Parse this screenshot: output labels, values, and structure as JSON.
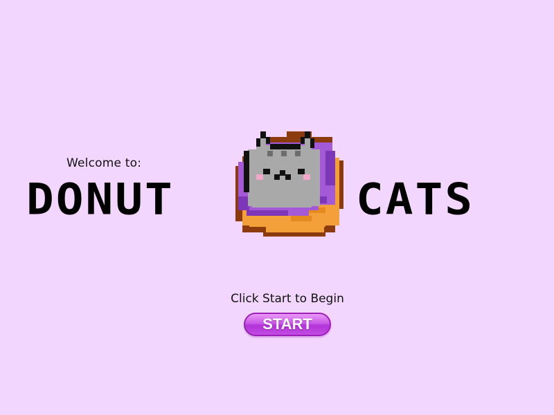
{
  "welcome_text": "Welcome to:",
  "logo": {
    "word_left": "DONUT",
    "word_right": "CATS"
  },
  "prompt_text": "Click Start to Begin",
  "start_button": {
    "label": "START"
  },
  "colors": {
    "background": "#f3d6fe",
    "button_fill": "#c34be2",
    "icing": "#a45ad6",
    "dough": "#f4a03a",
    "crust": "#8b3b0e",
    "cat_gray": "#a9a9a9",
    "blush": "#f4a6c9"
  }
}
